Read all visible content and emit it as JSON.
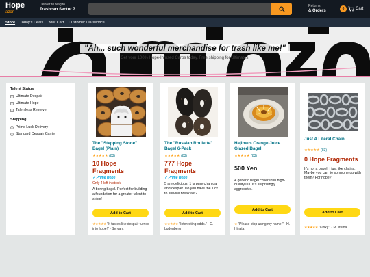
{
  "header": {
    "logo_line1": "Hope",
    "logo_line2": "azon",
    "deliver_label": "Deliver to Nagito",
    "deliver_location": "Trashcan Sector 7",
    "search_placeholder": "",
    "returns_label": "Returns",
    "orders_label": "& Orders",
    "cart_count": "0",
    "cart_label": "Cart"
  },
  "subnav": {
    "items": [
      "Store",
      "Today's Deals",
      "Your Cart",
      "Customer Dis-service"
    ]
  },
  "hero": {
    "title": "\"Ah... such wonderful merchandise for trash like me!\"",
    "subtitle": "Get your 100% Hope-Infused Carbs today. Free shipping for Ultimates."
  },
  "sidebar": {
    "status_heading": "Talent Status",
    "status_items": [
      "Ultimate Despair",
      "Ultimate Hope",
      "Talentless Reserve"
    ],
    "shipping_heading": "Shipping",
    "shipping_items": [
      "Prime Luck Delivery",
      "Standard Despair Carrier"
    ]
  },
  "products": [
    {
      "title": "The \"Stepping Stone\" Bagel (Plain)",
      "stars": "★★★★★",
      "rating_count": "(83)",
      "price": "10 Hope Fragments",
      "prime": "✓ Prime Hope",
      "stock": "Only 4 left in stock.",
      "desc": "A boring bagel. Perfect for building a foundation for a greater talent to shine!",
      "button": "Add to Cart",
      "review_stars": "★★★★★",
      "review": "\"It tastes like despair turned into hope!\" - Servant"
    },
    {
      "title": "The \"Russian Roulette\" Bagel 6-Pack",
      "stars": "★★★★★",
      "rating_count": "(83)",
      "price": "777 Hope Fragments",
      "prime": "✓ Prime Hope",
      "desc": "5 are delicious. 1 is pure charcoal and despair. Do you have the luck to survive breakfast?",
      "button": "Add to Cart",
      "review_stars": "★★★★★",
      "review": "\"Interesting odds.\" - C. Ludenberg"
    },
    {
      "title": "Hajime's Orange Juice Glazed Bagel",
      "stars": "★★★★★",
      "rating_count": "(83)",
      "price": "500 Yen",
      "desc": "A generic bagel covered in high-quality OJ. It's surprisingly aggressive.",
      "button": "Add to Cart",
      "review_stars": "★",
      "review": "\"Please stop using my name.\" - H. Hinata"
    },
    {
      "title": "Just A Literal Chain",
      "stars": "★★★★★",
      "rating_count": "(83)",
      "price": "0 Hope Fragments",
      "desc": "It's not a bagel. I just like chains. Maybe you can tie someone up with them? For hope?",
      "button": "Add to Cart",
      "review_stars": "★★★★★",
      "review": "\"Kinky.\" - M. Iruma"
    }
  ]
}
